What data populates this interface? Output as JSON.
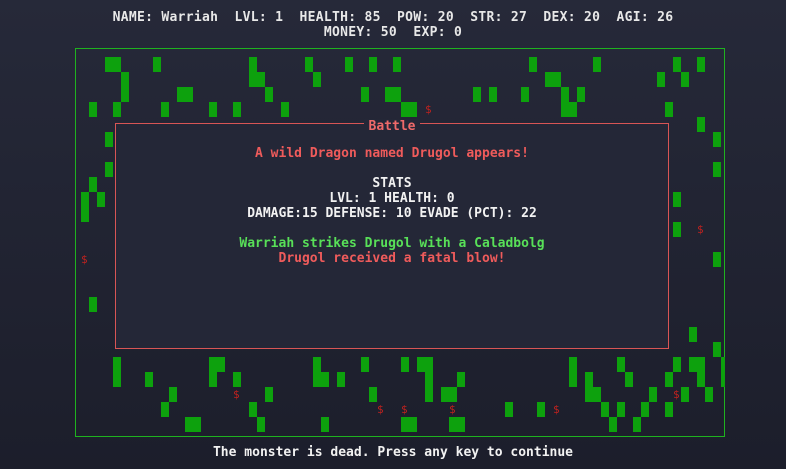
{
  "hud": {
    "line1": "NAME: Warriah  LVL: 1  HEALTH: 85  POW: 20  STR: 27  DEX: 20  AGI: 26",
    "line2": "MONEY: 50  EXP: 0"
  },
  "battle": {
    "title": "Battle",
    "encounter": "A wild Dragon named Drugol appears!",
    "stats_header": "STATS",
    "stats_line1": "LVL: 1 HEALTH: 0",
    "stats_line2": "DAMAGE:15 DEFENSE: 10 EVADE (PCT): 22",
    "attack_message": "Warriah strikes Drugol with a Caladbolg",
    "result_message": "Drugol received a fatal blow!"
  },
  "footer": {
    "prompt": "The monster is dead. Press any key to continue"
  },
  "map": {
    "gold_symbol": "$"
  },
  "colors": {
    "wall": "#0da10d",
    "border": "#1fb21f",
    "gold": "#c0221f",
    "battle_border": "#d85555"
  }
}
